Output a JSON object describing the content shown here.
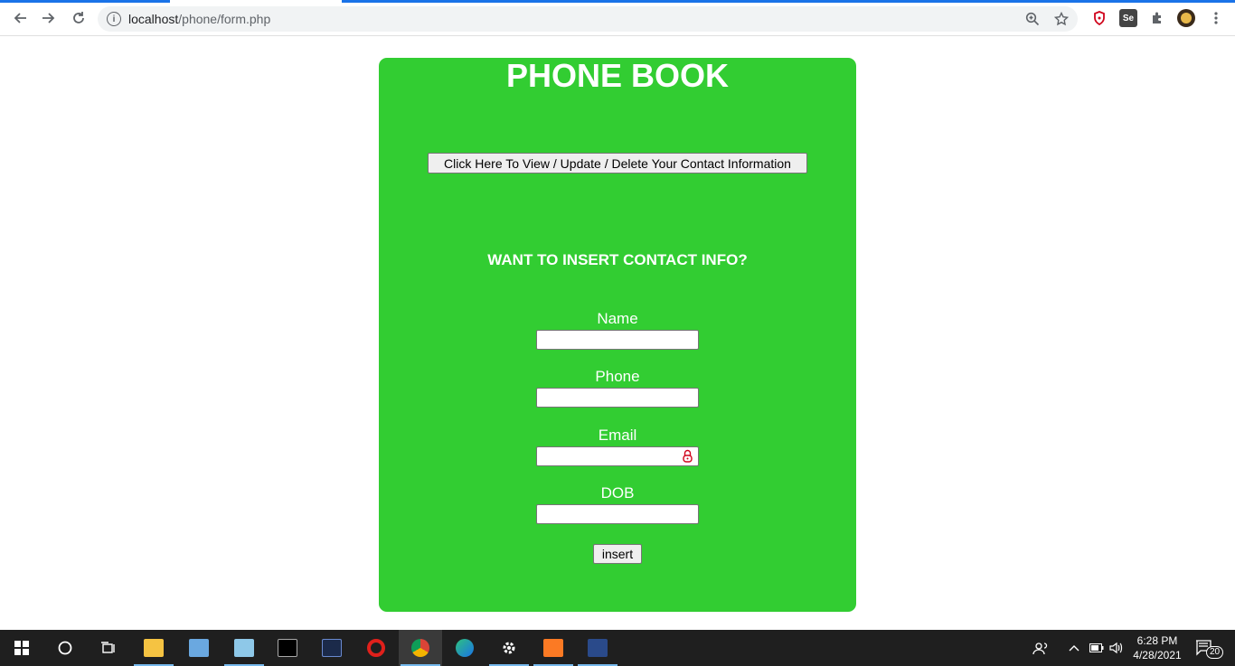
{
  "browser": {
    "url_host": "localhost",
    "url_path": "/phone/form.php",
    "accent_color": "#1a73e8"
  },
  "page": {
    "title": "PHONE BOOK",
    "view_button_label": "Click Here To View / Update / Delete Your Contact Information",
    "subtitle": "WANT TO INSERT CONTACT INFO?",
    "card_color": "#32cd32",
    "fields": [
      {
        "label": "Name",
        "value": ""
      },
      {
        "label": "Phone",
        "value": ""
      },
      {
        "label": "Email",
        "value": ""
      },
      {
        "label": "DOB",
        "value": ""
      }
    ],
    "insert_button_label": "insert"
  },
  "taskbar": {
    "time": "6:28 PM",
    "date": "4/28/2021",
    "notification_count": "20"
  }
}
